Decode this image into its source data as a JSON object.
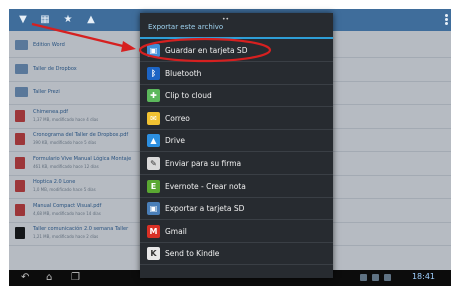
{
  "dialog": {
    "title": "Exportar este archivo",
    "items": [
      {
        "label": "Guardar en tarjeta SD",
        "icon": "sd-card-icon",
        "color": "#3f8fd8"
      },
      {
        "label": "Bluetooth",
        "icon": "bluetooth-icon",
        "color": "#1c64c4"
      },
      {
        "label": "Clip to cloud",
        "icon": "clip-to-cloud-icon",
        "color": "#5cb85c"
      },
      {
        "label": "Correo",
        "icon": "mail-envelope-icon",
        "color": "#f1c232"
      },
      {
        "label": "Drive",
        "icon": "drive-icon",
        "color": "#2c8fe0"
      },
      {
        "label": "Enviar para su firma",
        "icon": "signature-icon",
        "color": "#d9d9d9"
      },
      {
        "label": "Evernote - Crear nota",
        "icon": "evernote-icon",
        "color": "#5aa832"
      },
      {
        "label": "Exportar a tarjeta SD",
        "icon": "sd-export-icon",
        "color": "#4a7fb8"
      },
      {
        "label": "Gmail",
        "icon": "gmail-icon",
        "color": "#d93025"
      },
      {
        "label": "Send to Kindle",
        "icon": "kindle-icon",
        "color": "#e8e8e8"
      }
    ]
  },
  "files": [
    {
      "name": "Edition Word",
      "sub": "",
      "type": "folder"
    },
    {
      "name": "Taller de Dropbox",
      "sub": "",
      "type": "folder"
    },
    {
      "name": "Taller Prezi",
      "sub": "",
      "type": "folder"
    },
    {
      "name": "Chimenea.pdf",
      "sub": "1,37 MB, modificado hace 4 días",
      "type": "pdf"
    },
    {
      "name": "Cronograma del Taller de Dropbox.pdf",
      "sub": "390 KB, modificado hace 5 días",
      "type": "pdf"
    },
    {
      "name": "Formulario Vive Manual Lógica Montaje",
      "sub": "461 KB, modificado hace 12 días",
      "type": "pdf"
    },
    {
      "name": "Hoptica 2.0 Lone",
      "sub": "1,0 MB, modificado hace 5 días",
      "type": "pdf"
    },
    {
      "name": "Manual Compact Visual.pdf",
      "sub": "4,68 MB, modificado hace 14 días",
      "type": "pdf"
    },
    {
      "name": "Taller comunicación 2.0 semana Taller",
      "sub": "1,21 MB, modificado hace 2 días",
      "type": "black"
    }
  ],
  "status": {
    "clock": "18:41"
  }
}
